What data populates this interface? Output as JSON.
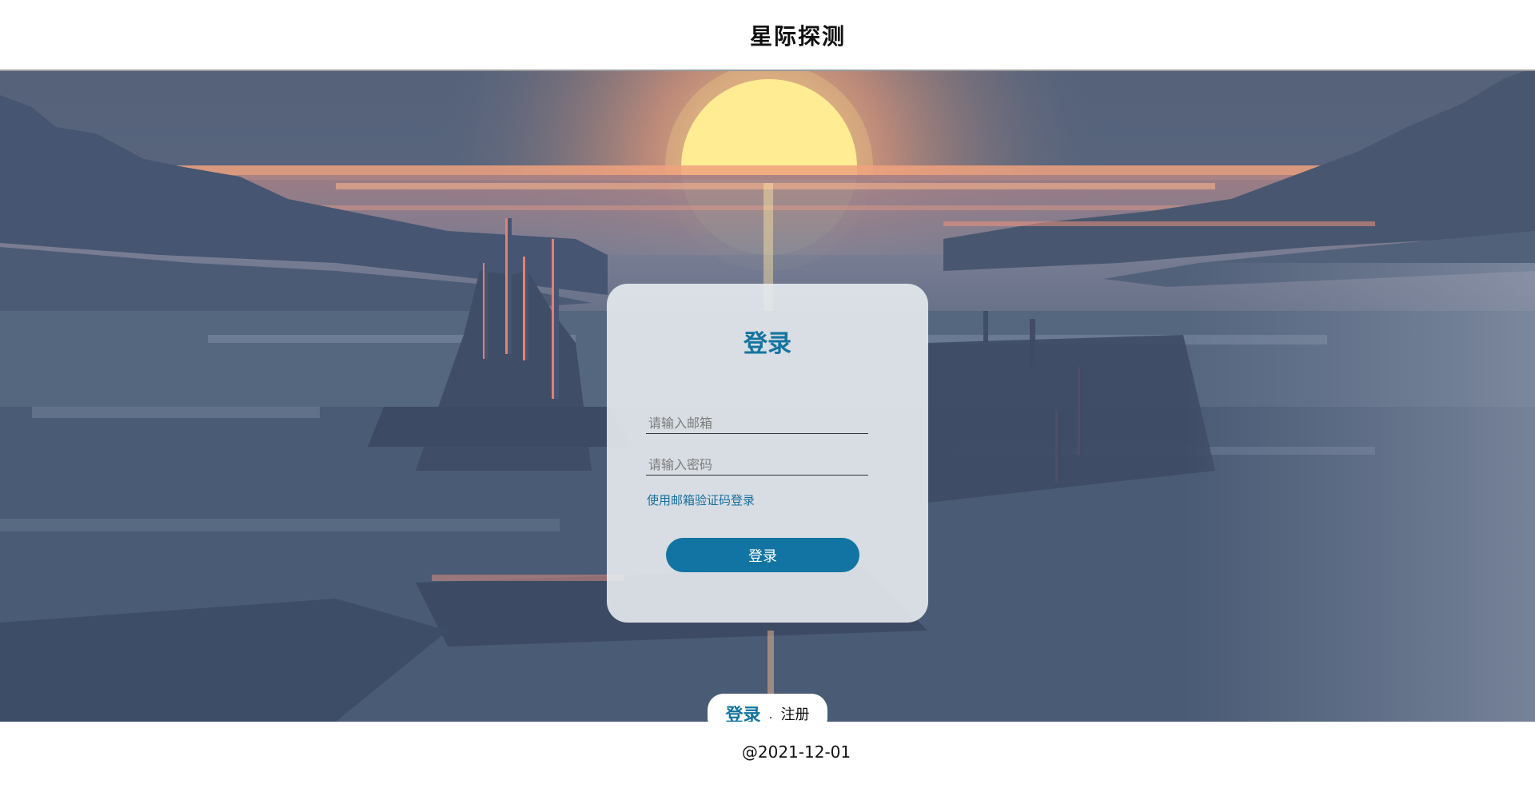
{
  "header": {
    "title": "星际探测"
  },
  "login_card": {
    "title": "登录",
    "email_placeholder": "请输入邮箱",
    "password_placeholder": "请输入密码",
    "alt_login_link": "使用邮箱验证码登录",
    "submit_label": "登录"
  },
  "switcher": {
    "login_label": "登录",
    "separator": ".",
    "register_label": "注册"
  },
  "footer": {
    "copyright": "@2021-12-01"
  },
  "colors": {
    "accent": "#1274a2",
    "card_bg": "#e7ebf0",
    "sky": "#4d5e78",
    "sun": "#fff196"
  }
}
